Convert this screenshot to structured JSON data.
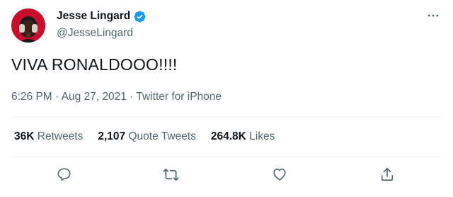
{
  "author": {
    "display_name": "Jesse Lingard",
    "handle": "@JesseLingard",
    "verified": true,
    "avatar_icon": "avatar-photo"
  },
  "tweet": {
    "text": "VIVA RONALDOOO!!!!",
    "time": "6:26 PM",
    "separator": "·",
    "date": "Aug 27, 2021",
    "source": "Twitter for iPhone"
  },
  "stats": {
    "retweets_count": "36K",
    "retweets_label": "Retweets",
    "quote_tweets_count": "2,107",
    "quote_tweets_label": "Quote Tweets",
    "likes_count": "264.8K",
    "likes_label": "Likes"
  },
  "actions": [
    {
      "name": "reply",
      "icon": "reply-icon"
    },
    {
      "name": "retweet",
      "icon": "retweet-icon"
    },
    {
      "name": "like",
      "icon": "heart-icon"
    },
    {
      "name": "share",
      "icon": "share-icon"
    }
  ],
  "colors": {
    "primary_text": "#0f1419",
    "secondary_text": "#536471",
    "verified_blue": "#1d9bf0",
    "divider": "#eff3f4",
    "avatar_bg": "#c8102e"
  }
}
